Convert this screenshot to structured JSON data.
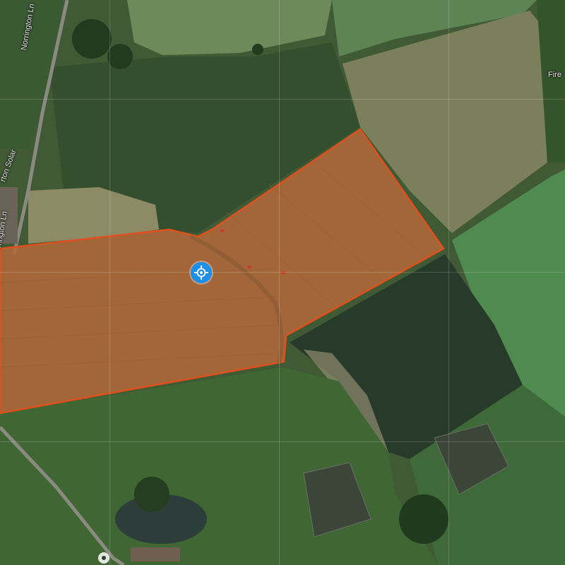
{
  "map": {
    "labels": {
      "norrington_ln_top": "Norrington Ln",
      "solar": "rton Solar",
      "norrington_ln_bottom": "rrington Ln",
      "edge": "Fire"
    },
    "colors": {
      "selection_fill": "#b5683a",
      "selection_stroke": "#e0501e",
      "locate_button": "#1e8fe6"
    },
    "icons": {
      "locate": "crosshair-icon",
      "compass": "compass-icon"
    }
  }
}
